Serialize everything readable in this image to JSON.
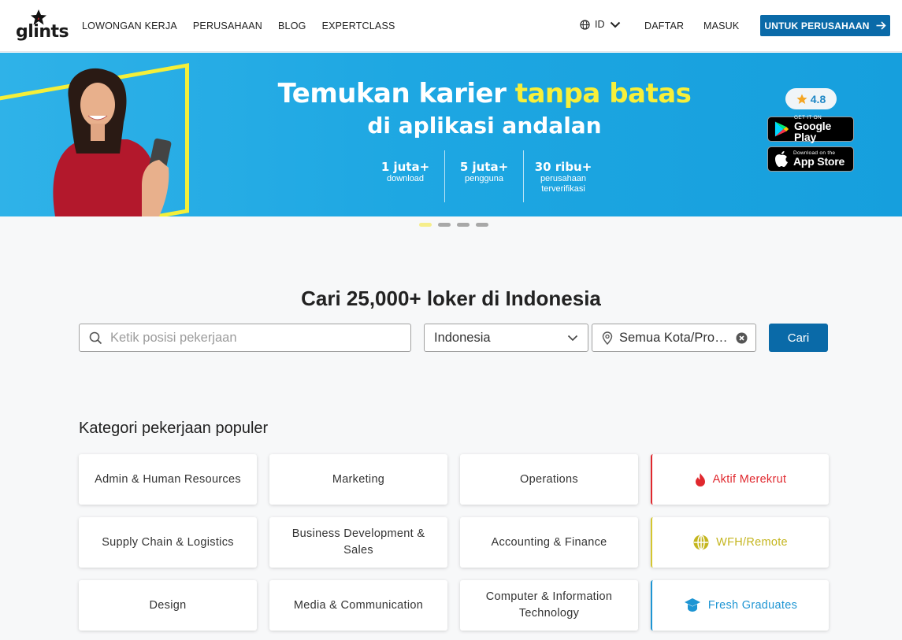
{
  "header": {
    "logo_text": "glints",
    "nav": [
      "LOWONGAN KERJA",
      "PERUSAHAAN",
      "BLOG",
      "EXPERTCLASS"
    ],
    "lang": "ID",
    "register": "DAFTAR",
    "login": "MASUK",
    "company_button": "UNTUK PERUSAHAAN"
  },
  "banner": {
    "title_plain": "Temukan karier ",
    "title_highlight": "tanpa batas",
    "subtitle": "di aplikasi andalan",
    "stats": [
      {
        "num": "1 juta+",
        "label": "download"
      },
      {
        "num": "5 juta+",
        "label": "pengguna"
      },
      {
        "num": "30 ribu+",
        "label": "perusahaan terverifikasi"
      }
    ],
    "rating": "4.8",
    "google_small": "GET IT ON",
    "google_big": "Google Play",
    "apple_small": "Download on the",
    "apple_big": "App Store",
    "slide_count": 4,
    "active_slide": 1
  },
  "search": {
    "title": "Cari 25,000+ loker di Indonesia",
    "position_placeholder": "Ketik posisi pekerjaan",
    "country": "Indonesia",
    "city": "Semua Kota/Provinsi",
    "button": "Cari"
  },
  "categories": {
    "title": "Kategori pekerjaan populer",
    "items": [
      "Admin & Human Resources",
      "Marketing",
      "Operations",
      "Aktif Merekrut",
      "Supply Chain & Logistics",
      "Business Development & Sales",
      "Accounting & Finance",
      "WFH/Remote",
      "Design",
      "Media & Communication",
      "Computer & Information Technology",
      "Fresh Graduates"
    ]
  },
  "colors": {
    "primary": "#0a6aa8",
    "banner": "#1ea7e2",
    "highlight": "#f7ef3a",
    "active_red": "#e0282e",
    "remote_yellow": "#c4b51e",
    "fresh_blue": "#1e95d3"
  },
  "icons": {
    "active": "flame-icon",
    "remote": "globe-icon",
    "fresh": "graduation-cap-icon"
  }
}
